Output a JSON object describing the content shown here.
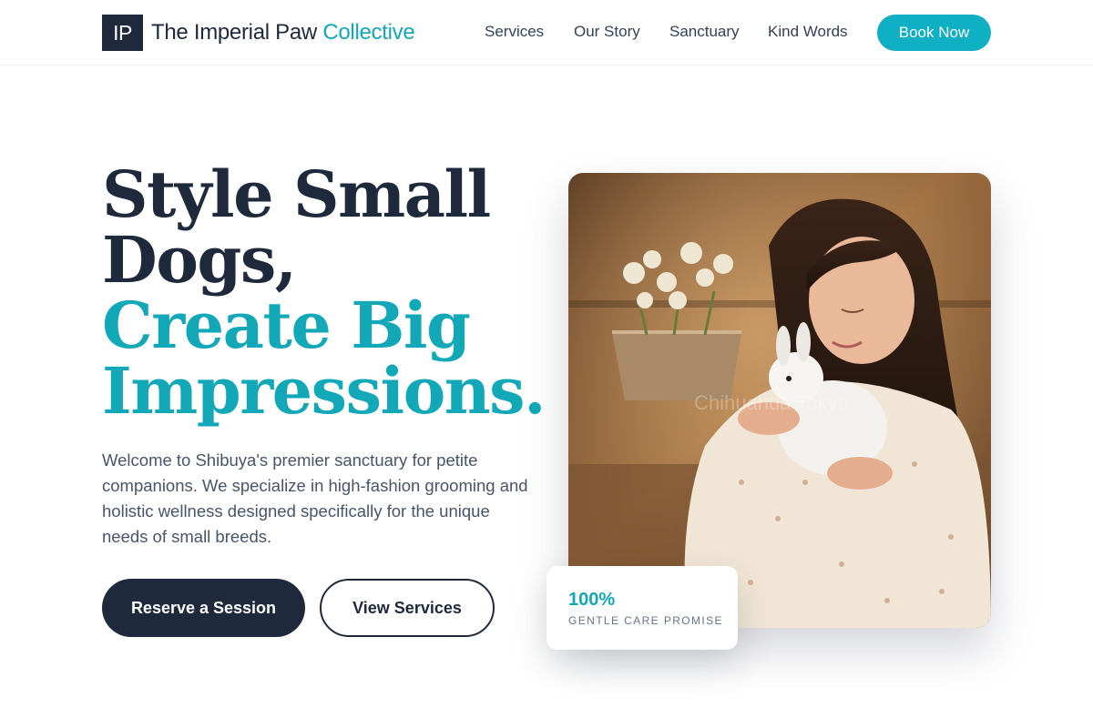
{
  "header": {
    "logo_mark": "IP",
    "brand_main": "The Imperial Paw",
    "brand_accent": "Collective",
    "nav": [
      "Services",
      "Our Story",
      "Sanctuary",
      "Kind Words"
    ],
    "cta_label": "Book Now"
  },
  "hero": {
    "headline_line1": "Style Small",
    "headline_line2": "Dogs,",
    "headline_line3": "Create Big",
    "headline_line4": "Impressions.",
    "intro": "Welcome to Shibuya's premier sanctuary for petite companions. We specialize in high-fashion grooming and holistic wellness designed specifically for the unique needs of small breeds.",
    "primary_button": "Reserve a Session",
    "secondary_button": "View Services",
    "photo_watermark": "Chihuahua Tokyo",
    "badge_value": "100%",
    "badge_label": "GENTLE CARE PROMISE"
  },
  "colors": {
    "navy": "#1e293b",
    "teal": "#12a8b8",
    "button_teal": "#0fb0c4",
    "body_text": "#475569"
  }
}
